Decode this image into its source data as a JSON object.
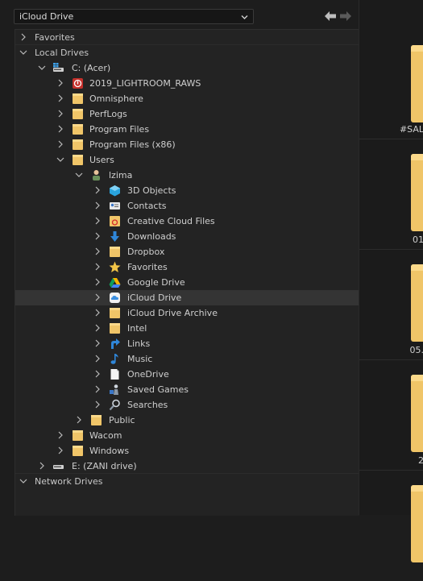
{
  "location_dropdown": {
    "value": "iCloud Drive"
  },
  "tree": {
    "sections": {
      "favorites": "Favorites",
      "local_drives": "Local Drives",
      "network_drives": "Network Drives"
    },
    "drive_c": "C: (Acer)",
    "drive_e": "E: (ZANI drive)",
    "c_items": [
      "2019_LIGHTROOM_RAWS",
      "Omnisphere",
      "PerfLogs",
      "Program Files",
      "Program Files (x86)",
      "Users"
    ],
    "user": "lzima",
    "user_items": [
      "3D Objects",
      "Contacts",
      "Creative Cloud Files",
      "Downloads",
      "Dropbox",
      "Favorites",
      "Google Drive",
      "iCloud Drive",
      "iCloud Drive Archive",
      "Intel",
      "Links",
      "Music",
      "OneDrive",
      "Saved Games",
      "Searches"
    ],
    "users_public": "Public",
    "c_items_after": [
      "Wacom",
      "Windows"
    ],
    "selected": "iCloud Drive"
  },
  "preview_tiles": [
    "#SAL",
    "01",
    "05.",
    "2"
  ],
  "icons": {
    "back": "arrow-left-icon",
    "forward": "arrow-right-icon",
    "drive": "drive-icon",
    "folder": "folder-icon",
    "lightroom": "lightroom-folder-icon",
    "user": "user-icon",
    "objects3d": "cube-icon",
    "contacts": "contact-card-icon",
    "creative_cloud": "creative-cloud-folder-icon",
    "downloads": "download-arrow-icon",
    "favorites": "star-icon",
    "google_drive": "google-drive-icon",
    "icloud": "cloud-icon",
    "links": "link-arrow-icon",
    "music": "music-note-icon",
    "onedrive": "document-icon",
    "saved_games": "game-piece-icon",
    "searches": "magnifier-icon"
  },
  "colors": {
    "folder": "#f0c568",
    "selected_row": "#343434",
    "background": "#1d1d1d"
  }
}
